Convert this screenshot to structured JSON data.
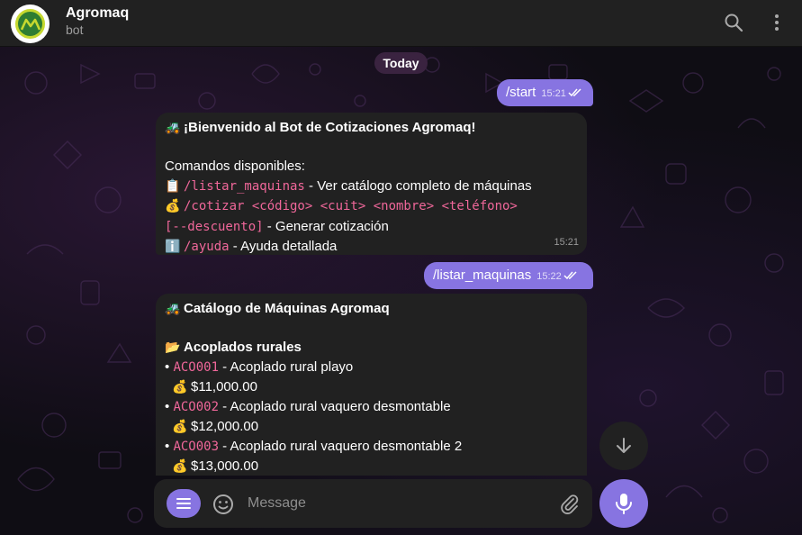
{
  "header": {
    "title": "Agromaq",
    "subtitle": "bot",
    "avatar_text": "AM"
  },
  "date_divider": "Today",
  "messages": {
    "m1": {
      "text": "/start",
      "time": "15:21"
    },
    "m2": {
      "line1_emoji": "🚜",
      "line1": "¡Bienvenido al Bot de Cotizaciones Agromaq!",
      "line2": "Comandos disponibles:",
      "cmd1_emoji": "📋",
      "cmd1": "/listar_maquinas",
      "cmd1_desc": " - Ver catálogo completo de máquinas",
      "cmd2_emoji": "💰",
      "cmd2": "/cotizar <código> <cuit> <nombre> <teléfono>",
      "cmd2_cont": "[--descuento]",
      "cmd2_desc": " - Generar cotización",
      "cmd3_emoji": "ℹ️",
      "cmd3": "/ayuda",
      "cmd3_desc": " - Ayuda detallada",
      "time": "15:21"
    },
    "m3": {
      "text": "/listar_maquinas",
      "time": "15:22"
    },
    "m4": {
      "title_emoji": "🚜",
      "title": "Catálogo de Máquinas Agromaq",
      "section_emoji": "📂",
      "section": "Acoplados rurales",
      "items": [
        {
          "bullet": "•",
          "code": "ACO001",
          "desc": " - Acoplado rural playo",
          "price_emoji": "💰",
          "price": "$11,000.00"
        },
        {
          "bullet": "•",
          "code": "ACO002",
          "desc": " - Acoplado rural vaquero desmontable",
          "price_emoji": "💰",
          "price": "$12,000.00"
        },
        {
          "bullet": "•",
          "code": "ACO003",
          "desc": " - Acoplado rural vaquero desmontable 2",
          "price_emoji": "💰",
          "price": "$13,000.00"
        }
      ]
    }
  },
  "composer": {
    "placeholder": "Message"
  },
  "icons": {
    "search": "search-icon",
    "more": "more-vertical-icon",
    "menu": "menu-icon",
    "emoji": "emoji-icon",
    "attach": "paperclip-icon",
    "mic": "microphone-icon",
    "scroll": "arrow-down-icon"
  },
  "colors": {
    "accent": "#8774e1",
    "bubble_in": "#212121",
    "command": "#f0679a",
    "header": "#212121"
  }
}
